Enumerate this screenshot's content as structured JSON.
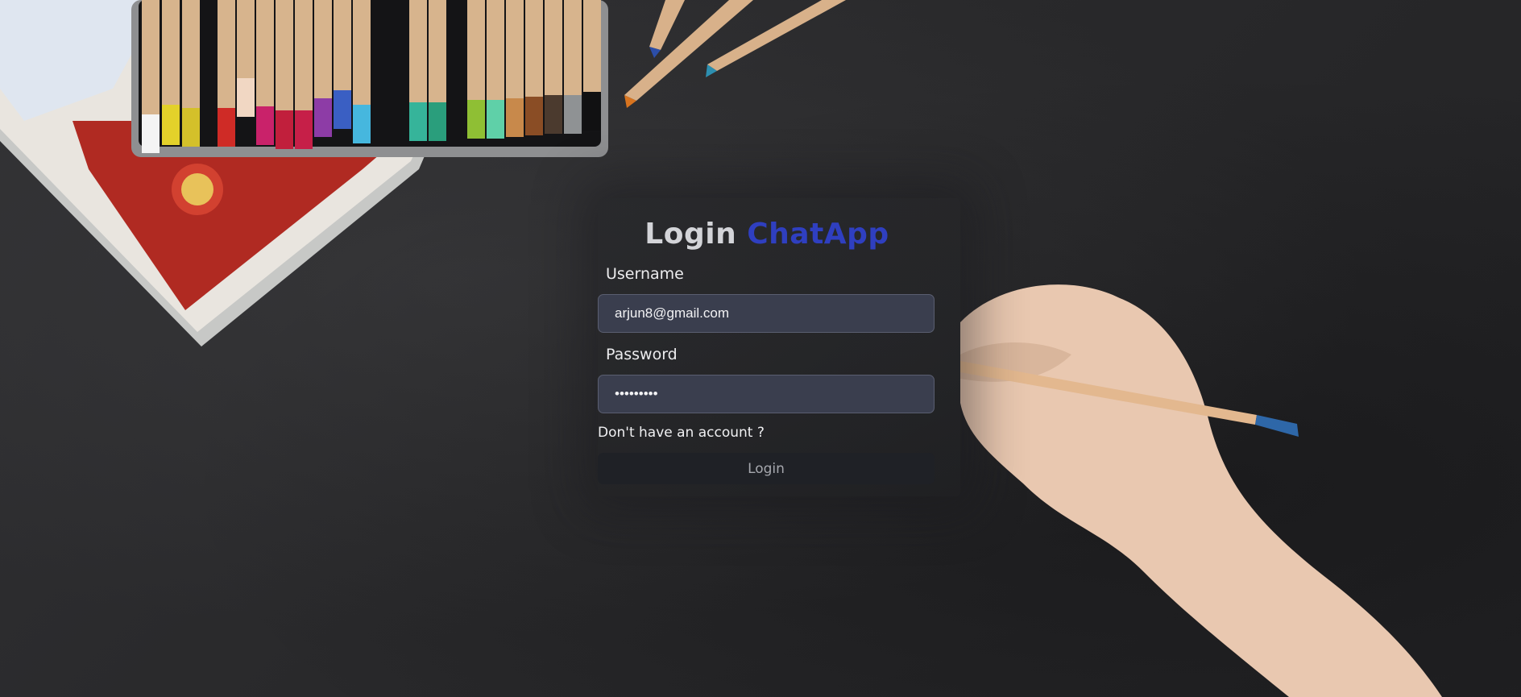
{
  "title": {
    "prefix": "Login",
    "brand": "ChatApp"
  },
  "form": {
    "username_label": "Username",
    "username_value": "arjun8@gmail.com",
    "password_label": "Password",
    "password_value": "123456789",
    "signup_link": "Don't have an account ?",
    "login_button": "Login"
  },
  "colors": {
    "brand": "#2f3fc0",
    "background": "#28282a",
    "input_bg": "#3a3e4e"
  }
}
